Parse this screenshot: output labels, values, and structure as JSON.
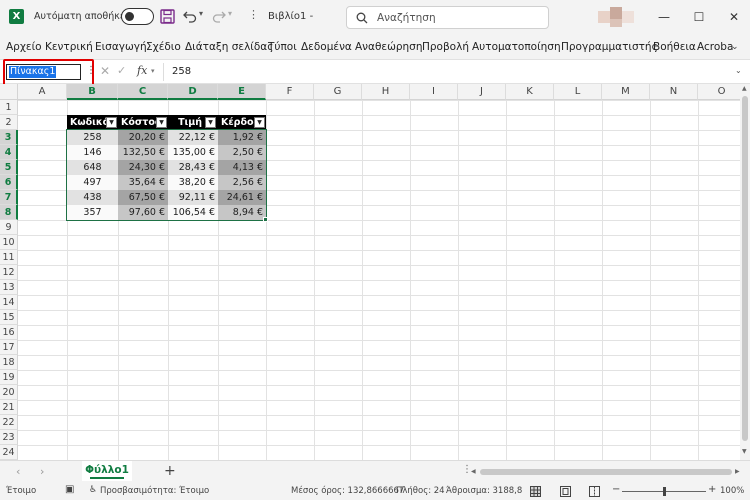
{
  "titlebar": {
    "app_icon_letter": "X",
    "autosave_label": "Αυτόματη αποθήκευση",
    "doc_title": "Βιβλίο1  -",
    "search_placeholder": "Αναζήτηση"
  },
  "menu": [
    "Αρχείο",
    "Κεντρική",
    "Εισαγωγή",
    "Σχέδιο",
    "Διάταξη σελίδας",
    "Τύποι",
    "Δεδομένα",
    "Αναθεώρηση",
    "Προβολή",
    "Αυτοματοποίηση",
    "Προγραμματιστής",
    "Βοήθεια",
    "Acroba"
  ],
  "formula_bar": {
    "name_box": "Πίνακας1",
    "fx": "fx",
    "value": "258"
  },
  "columns": [
    "A",
    "B",
    "C",
    "D",
    "E",
    "F",
    "G",
    "H",
    "I",
    "J",
    "K",
    "L",
    "M",
    "N",
    "O"
  ],
  "rows": [
    "1",
    "2",
    "3",
    "4",
    "5",
    "6",
    "7",
    "8",
    "9",
    "10",
    "11",
    "12",
    "13",
    "14",
    "15",
    "16",
    "17",
    "18",
    "19",
    "20",
    "21",
    "22",
    "23",
    "24"
  ],
  "table": {
    "headers": [
      "Κωδικός",
      "Κόστος",
      "Τιμή",
      "Κέρδος"
    ],
    "rows": [
      [
        "258",
        "20,20 €",
        "22,12 €",
        "1,92 €"
      ],
      [
        "146",
        "132,50 €",
        "135,00 €",
        "2,50 €"
      ],
      [
        "648",
        "24,30 €",
        "28,43 €",
        "4,13 €"
      ],
      [
        "497",
        "35,64 €",
        "38,20 €",
        "2,56 €"
      ],
      [
        "438",
        "67,50 €",
        "92,11 €",
        "24,61 €"
      ],
      [
        "357",
        "97,60 €",
        "106,54 €",
        "8,94 €"
      ]
    ]
  },
  "sheet": {
    "tab": "Φύλλο1",
    "add": "+"
  },
  "status": {
    "ready": "Έτοιμο",
    "accessibility": "Προσβασιμότητα: Έτοιμο",
    "average": "Μέσος όρος: 132,8666667",
    "count": "Πλήθος: 24",
    "sum": "Άθροισμα: 3188,8",
    "zoom": "100%"
  },
  "colors": {
    "accent": "#107c41",
    "header_fill": "#000000",
    "highlight": "#e10000"
  }
}
